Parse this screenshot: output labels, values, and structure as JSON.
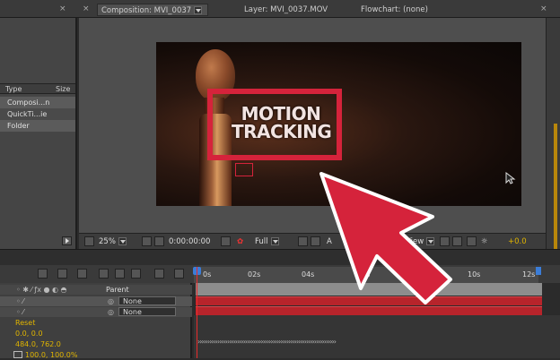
{
  "tabs": {
    "composition": "Composition: MVI_0037",
    "layer": "Layer: MVI_0037.MOV",
    "flowchart": "Flowchart: (none)"
  },
  "project": {
    "columns": {
      "type": "Type",
      "size": "Size"
    },
    "rows": [
      "Composi...n",
      "QuickTi...ie",
      "Folder"
    ]
  },
  "viewer": {
    "overlay_text": "MOTION\nTRACKING",
    "zoom": "25%",
    "timecode": "0:00:00:00",
    "resolution": "Full",
    "view_label": "View",
    "partial_label": "A",
    "exposure": "+0.0"
  },
  "timeline": {
    "ruler_labels": [
      "0s",
      "02s",
      "04s",
      "06s",
      "10s",
      "12s"
    ],
    "parent_header": "Parent",
    "layer_parents": [
      "None",
      "None"
    ],
    "properties": [
      "Reset",
      "0.0, 0.0",
      "484.0, 762.0",
      "100.0, 100.0%"
    ]
  },
  "colors": {
    "accent_red": "#d5233b",
    "bar_red": "#b7242b",
    "value_orange": "#e0b400",
    "playhead_blue": "#3b7dd8"
  },
  "icons": [
    "close-icon",
    "dropdown-icon",
    "play-icon",
    "arrow-pointer-icon",
    "mouse-cursor-icon"
  ]
}
